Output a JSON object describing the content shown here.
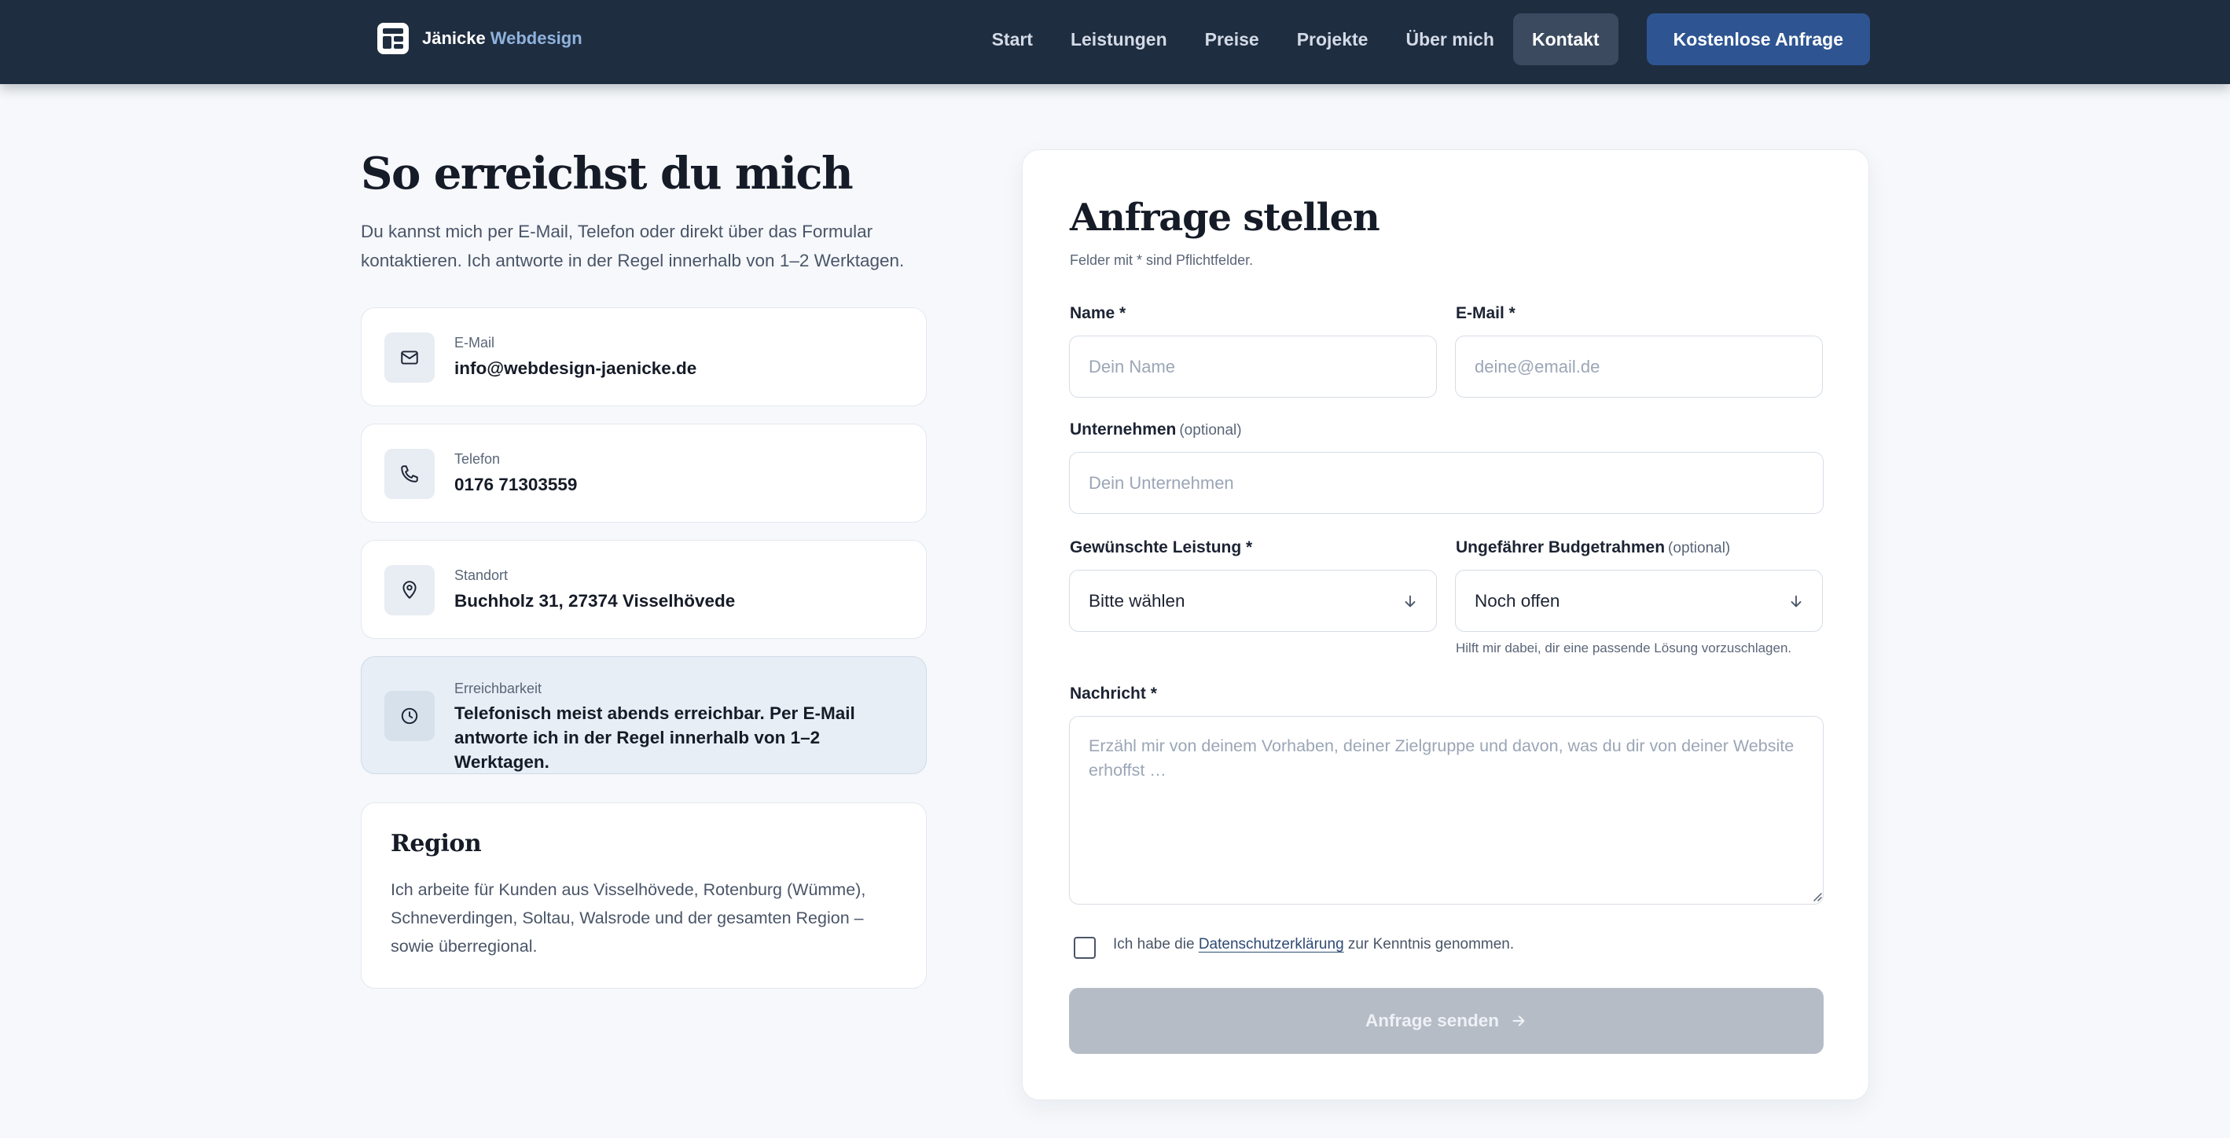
{
  "header": {
    "brand_name": "Jänicke",
    "brand_accent": "Webdesign",
    "nav": [
      {
        "label": "Start"
      },
      {
        "label": "Leistungen"
      },
      {
        "label": "Preise"
      },
      {
        "label": "Projekte"
      },
      {
        "label": "Über mich"
      },
      {
        "label": "Kontakt",
        "active": true
      }
    ],
    "cta_label": "Kostenlose Anfrage"
  },
  "contact": {
    "title": "So erreichst du mich",
    "intro": "Du kannst mich per E-Mail, Telefon oder direkt über das Formular kontaktieren. Ich antworte in der Regel innerhalb von 1–2 Werktagen.",
    "cards": [
      {
        "label": "E-Mail",
        "value": "info@webdesign-jaenicke.de",
        "icon": "mail-icon"
      },
      {
        "label": "Telefon",
        "value": "0176 71303559",
        "icon": "phone-icon"
      },
      {
        "label": "Standort",
        "value": "Buchholz 31, 27374 Visselhövede",
        "icon": "map-pin-icon"
      },
      {
        "label": "Erreichbarkeit",
        "value": "Telefonisch meist abends erreichbar. Per E-Mail antworte ich in der Regel innerhalb von 1–2 Werktagen.",
        "icon": "clock-icon"
      }
    ],
    "region": {
      "title": "Region",
      "text": "Ich arbeite für Kunden aus Visselhövede, Rotenburg (Wümme), Schneverdingen, Soltau, Walsrode und der gesamten Region – sowie überregional."
    }
  },
  "form": {
    "title": "Anfrage stellen",
    "hint": "Felder mit * sind Pflichtfelder.",
    "name": {
      "label": "Name *",
      "placeholder": "Dein Name",
      "value": ""
    },
    "email": {
      "label": "E-Mail *",
      "placeholder": "deine@email.de",
      "value": ""
    },
    "company": {
      "label": "Unternehmen",
      "optional": "(optional)",
      "placeholder": "Dein Unternehmen",
      "value": ""
    },
    "service": {
      "label": "Gewünschte Leistung *",
      "selected": "Bitte wählen"
    },
    "budget": {
      "label": "Ungefährer Budgetrahmen",
      "optional": "(optional)",
      "selected": "Noch offen",
      "help": "Hilft mir dabei, dir eine passende Lösung vorzuschlagen."
    },
    "message": {
      "label": "Nachricht *",
      "placeholder": "Erzähl mir von deinem Vorhaben, deiner Zielgruppe und davon, was du dir von deiner Website erhoffst …",
      "value": ""
    },
    "consent": {
      "before": "Ich habe die ",
      "link": "Datenschutzerklärung",
      "after": " zur Kenntnis genommen.",
      "checked": false
    },
    "submit_label": "Anfrage senden"
  },
  "colors": {
    "header_bg": "#1f2d40",
    "accent": "#2e5592",
    "page_bg": "#f6f8fb",
    "submit_disabled": "#b6bcc6"
  }
}
